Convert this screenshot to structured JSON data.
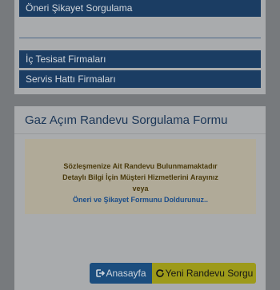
{
  "nav": {
    "items": [
      {
        "label": ""
      },
      {
        "label": "Öneri Şikayet Sorgulama"
      },
      {
        "label": "İç Tesisat Firmaları"
      },
      {
        "label": "Servis Hattı Firmaları"
      }
    ]
  },
  "form": {
    "title": "Gaz Açım Randevu Sorgulama Formu",
    "notice": {
      "line1": "Sözleşmenize Ait Randevu Bulunmamaktadır",
      "line2": "Detaylı Bilgi İçin Müşteri Hizmetlerini Arayınız",
      "line3": "veya",
      "link": "Öneri ve Şikayet Formunu Doldurunuz.."
    },
    "buttons": {
      "home_icon": "sign-out-icon",
      "home_label": "Anasayfa",
      "new_icon": "refresh-icon",
      "new_label": "Yeni Randevu Sorgu"
    }
  },
  "colors": {
    "nav_button": "#1b3d63",
    "title": "#1a3556",
    "notice_bg": "#b0aa98",
    "home_button": "#1b4d7e",
    "new_button": "#9d9a1a"
  }
}
